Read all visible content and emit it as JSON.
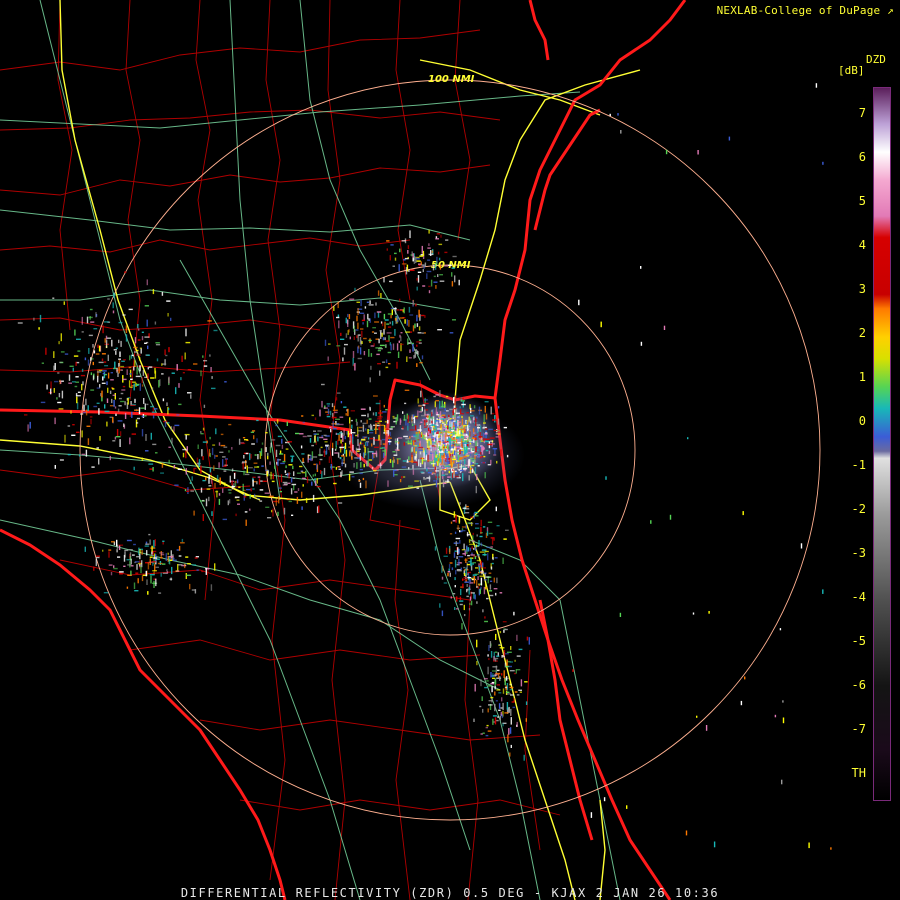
{
  "header": {
    "credit": "NEXLAB-College of DuPage",
    "credit_icon": "external-link-icon"
  },
  "legend": {
    "product": "DZD",
    "unit": "[dB]",
    "ticks": [
      "7",
      "6",
      "5",
      "4",
      "3",
      "2",
      "1",
      "0",
      "-1",
      "-2",
      "-3",
      "-4",
      "-5",
      "-6",
      "-7",
      "TH"
    ],
    "colors": {
      "top": "#5b1f5b",
      "white": "#ffffff",
      "pink": "#e27ab6",
      "red": "#d60000",
      "orange": "#ff7a00",
      "yellow": "#ffff00",
      "green": "#55d455",
      "cyan": "#18b8b8",
      "blue": "#3b5cd6",
      "grey": "#9a9a9a",
      "dark": "#141414"
    }
  },
  "range_rings": [
    {
      "label": "100 NMI",
      "radius_nm": 100
    },
    {
      "label": "50 NMI",
      "radius_nm": 50
    }
  ],
  "map_colors": {
    "state_borders": "#ff1a1a",
    "county_borders": "#b00000",
    "interstates": "#ffff33",
    "highways": "#7ad8a0",
    "range_rings": "#ffb090"
  },
  "footer": {
    "caption": "DIFFERENTIAL REFLECTIVITY (ZDR) 0.5 DEG - KJAX 2 JAN 26 10:36"
  }
}
